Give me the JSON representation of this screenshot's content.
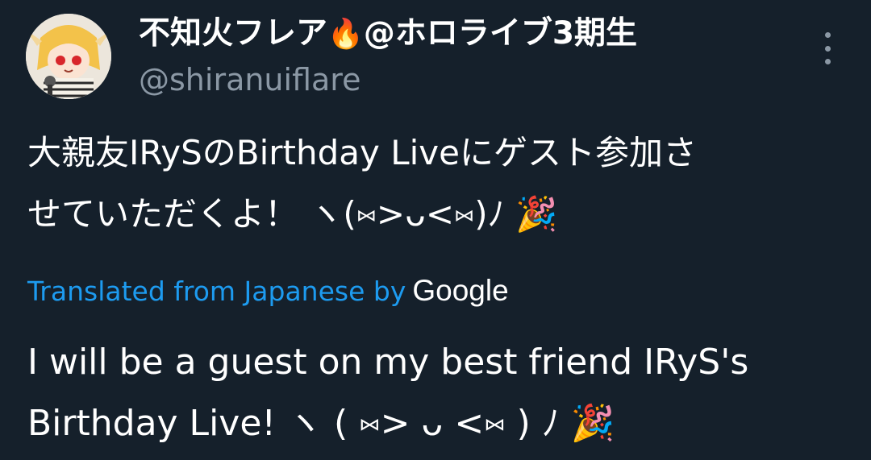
{
  "author": {
    "display_name": "不知火フレア",
    "name_emoji": "🔥",
    "name_suffix": "@ホロライブ3期生",
    "handle": "@shiranuiflare",
    "avatar_icon": "avatar-image"
  },
  "menu": {
    "icon": "more-vertical-icon"
  },
  "tweet": {
    "lines": [
      "大親友IRySのBirthday Liveにゲスト参加さ",
      "せていただくよ！ ヽ(⑅>ᴗ<⑅)ﾉ 🎉"
    ]
  },
  "translation_notice": {
    "text": "Translated from Japanese by",
    "provider": "Google"
  },
  "translation": {
    "lines": [
      "I will be a guest on my best friend IRyS's",
      "Birthday Live! ヽ ( ⑅> ᴗ <⑅ ) ﾉ 🎉"
    ]
  },
  "colors": {
    "background": "#15202b",
    "secondary_text": "#8b98a5",
    "link": "#1d9bf0"
  }
}
